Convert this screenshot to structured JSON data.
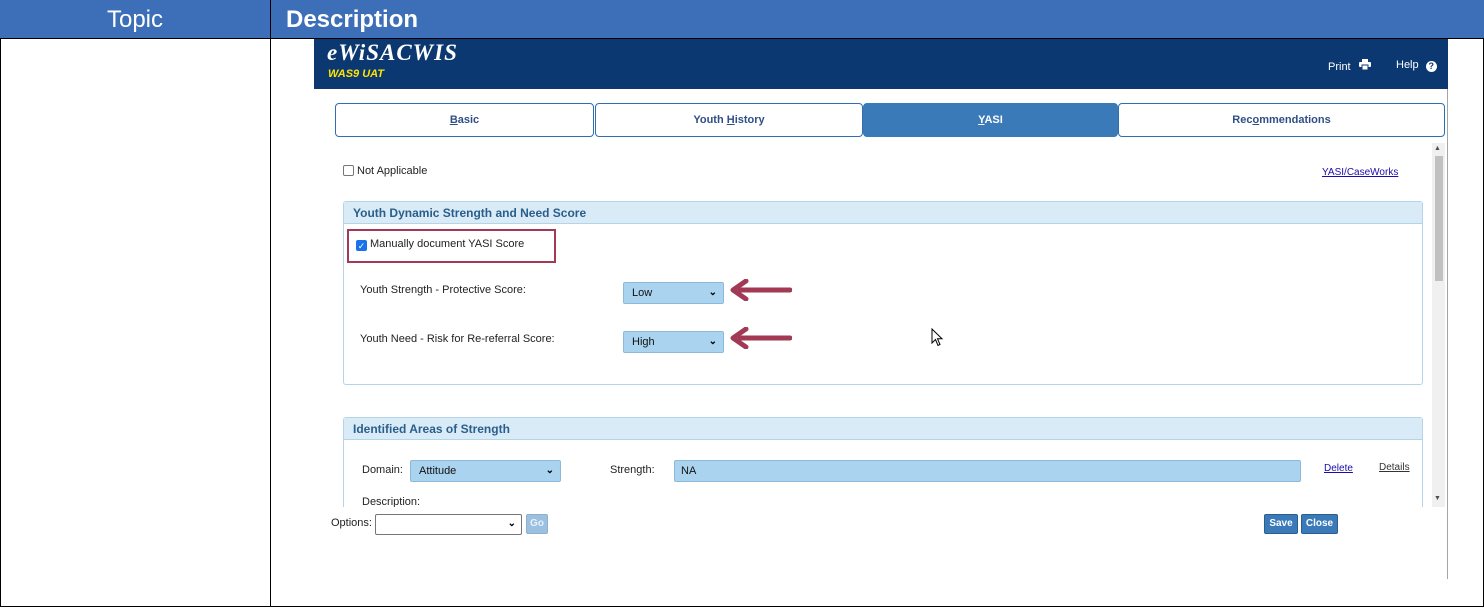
{
  "doc": {
    "topic_header": "Topic",
    "description_header": "Description"
  },
  "app": {
    "logo": "eWiSACWIS",
    "environment": "WAS9 UAT",
    "print_label": "Print",
    "help_label": "Help",
    "colors": {
      "banner": "#0b3870",
      "accent": "#3a7ab8",
      "highlight_box": "#a33a55"
    }
  },
  "tabs": [
    {
      "pre": "",
      "u": "B",
      "post": "asic"
    },
    {
      "pre": "Youth ",
      "u": "H",
      "post": "istory"
    },
    {
      "pre": "",
      "u": "Y",
      "post": "ASI"
    },
    {
      "pre": "Rec",
      "u": "o",
      "post": "mmendations"
    }
  ],
  "active_tab": "YASI",
  "not_applicable_label": "Not Applicable",
  "yasi_link": "YASI/CaseWorks",
  "panel1": {
    "title": "Youth Dynamic Strength and Need Score",
    "manual_label": "Manually document YASI Score",
    "strength_label": "Youth Strength - Protective Score:",
    "strength_value": "Low",
    "need_label": "Youth Need - Risk for Re-referral Score:",
    "need_value": "High"
  },
  "panel2": {
    "title": "Identified Areas of Strength",
    "domain_label": "Domain:",
    "domain_value": "Attitude",
    "strength_label": "Strength:",
    "strength_value": "NA",
    "delete_label": "Delete",
    "details_label": "Details",
    "description_label": "Description:"
  },
  "footer": {
    "options_label": "Options:",
    "go_label": "Go",
    "save_label": "Save",
    "close_label": "Close"
  }
}
